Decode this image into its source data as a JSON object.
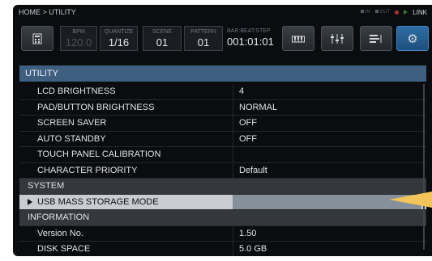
{
  "breadcrumb": "HOME > UTILITY",
  "status": {
    "in_label": "IN",
    "out_label": "OUT",
    "link_label": "LINK"
  },
  "toolbar": {
    "bpm": {
      "label": "BPM",
      "value": "120.0"
    },
    "quantize": {
      "label": "QUANTIZE",
      "value": "1/16"
    },
    "scene": {
      "label": "SCENE",
      "value": "01"
    },
    "pattern": {
      "label": "PATTERN",
      "value": "01"
    },
    "bar_beat_step": {
      "label": "BAR:BEAT:STEP",
      "value": "001:01:01"
    },
    "icons": [
      "calculator-icon",
      "keyboard-icon",
      "mixer-icon",
      "sequence-icon",
      "gear-icon"
    ]
  },
  "section_title": "UTILITY",
  "rows": [
    {
      "name": "LCD BRIGHTNESS",
      "value": "4"
    },
    {
      "name": "PAD/BUTTON BRIGHTNESS",
      "value": "NORMAL"
    },
    {
      "name": "SCREEN SAVER",
      "value": "OFF"
    },
    {
      "name": "AUTO STANDBY",
      "value": "OFF"
    },
    {
      "name": "TOUCH PANEL CALIBRATION",
      "value": ""
    },
    {
      "name": "CHARACTER PRIORITY",
      "value": "Default"
    }
  ],
  "system_header": "SYSTEM",
  "selected_row": {
    "name": "USB MASS STORAGE MODE",
    "value": ""
  },
  "information_header": "INFORMATION",
  "info_rows": [
    {
      "name": "Version No.",
      "value": "1.50"
    },
    {
      "name": "DISK SPACE",
      "value": "5.0 GB"
    }
  ],
  "colors": {
    "accent_blue": "#3f5f80",
    "active_button": "#2f6da6",
    "pointer": "#f2c45a"
  }
}
